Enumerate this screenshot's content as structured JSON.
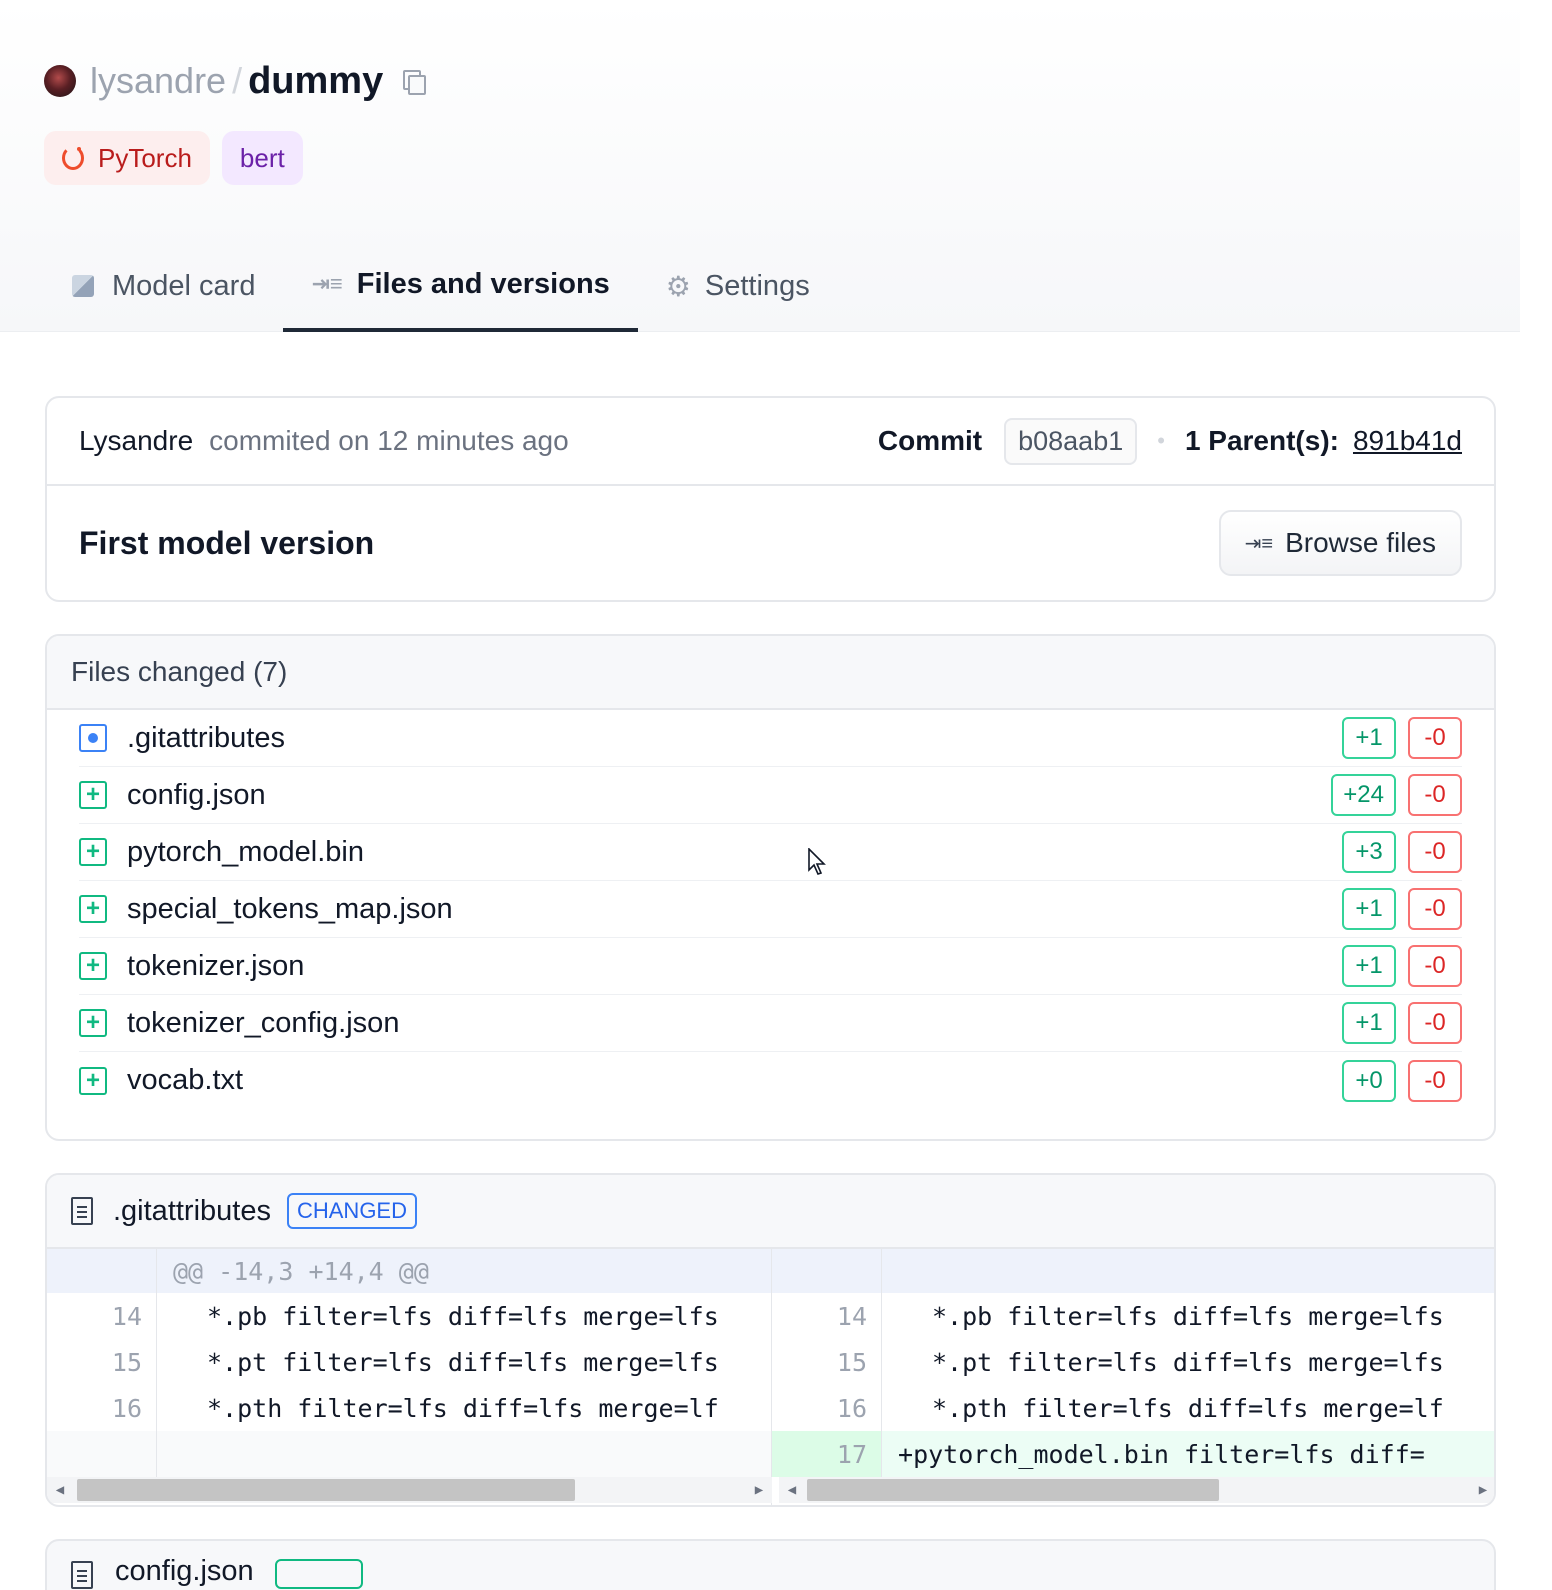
{
  "repo": {
    "owner": "lysandre",
    "separator": "/",
    "name": "dummy"
  },
  "tags": [
    {
      "label": "PyTorch",
      "icon": "pytorch-icon"
    },
    {
      "label": "bert"
    }
  ],
  "tabs": [
    {
      "label": "Model card",
      "icon": "cube-icon"
    },
    {
      "label": "Files and versions",
      "icon": "files-icon",
      "active": true
    },
    {
      "label": "Settings",
      "icon": "gear-icon"
    }
  ],
  "commit": {
    "author": "Lysandre",
    "when": "commited on 12 minutes ago",
    "commit_label": "Commit",
    "hash": "b08aab1",
    "parents_label": "1 Parent(s):",
    "parent_hash": "891b41d",
    "title": "First model version",
    "browse_label": "Browse files"
  },
  "files_changed": {
    "header": "Files changed (7)",
    "files": [
      {
        "name": ".gitattributes",
        "status": "modified",
        "plus": "+1",
        "minus": "-0"
      },
      {
        "name": "config.json",
        "status": "added",
        "plus": "+24",
        "minus": "-0"
      },
      {
        "name": "pytorch_model.bin",
        "status": "added",
        "plus": "+3",
        "minus": "-0"
      },
      {
        "name": "special_tokens_map.json",
        "status": "added",
        "plus": "+1",
        "minus": "-0"
      },
      {
        "name": "tokenizer.json",
        "status": "added",
        "plus": "+1",
        "minus": "-0"
      },
      {
        "name": "tokenizer_config.json",
        "status": "added",
        "plus": "+1",
        "minus": "-0"
      },
      {
        "name": "vocab.txt",
        "status": "added",
        "plus": "+0",
        "minus": "-0"
      }
    ]
  },
  "diff": {
    "file": ".gitattributes",
    "badge": "CHANGED",
    "hunk": "@@ -14,3 +14,4 @@",
    "left_lines": [
      {
        "num": "14",
        "text": "*.pb filter=lfs diff=lfs merge=lfs"
      },
      {
        "num": "15",
        "text": "*.pt filter=lfs diff=lfs merge=lfs"
      },
      {
        "num": "16",
        "text": "*.pth filter=lfs diff=lfs merge=lf"
      }
    ],
    "right_lines": [
      {
        "num": "14",
        "text": "*.pb filter=lfs diff=lfs merge=lfs"
      },
      {
        "num": "15",
        "text": "*.pt filter=lfs diff=lfs merge=lfs"
      },
      {
        "num": "16",
        "text": "*.pth filter=lfs diff=lfs merge=lf"
      }
    ],
    "added_line": {
      "num": "17",
      "sign": "+",
      "text": "pytorch_model.bin filter=lfs diff="
    }
  },
  "next_diff": {
    "file": "config.json"
  },
  "colors": {
    "added": "#10b981",
    "removed": "#ef4444",
    "modified": "#3b82f6",
    "pytorch": "#ee4c2c"
  }
}
